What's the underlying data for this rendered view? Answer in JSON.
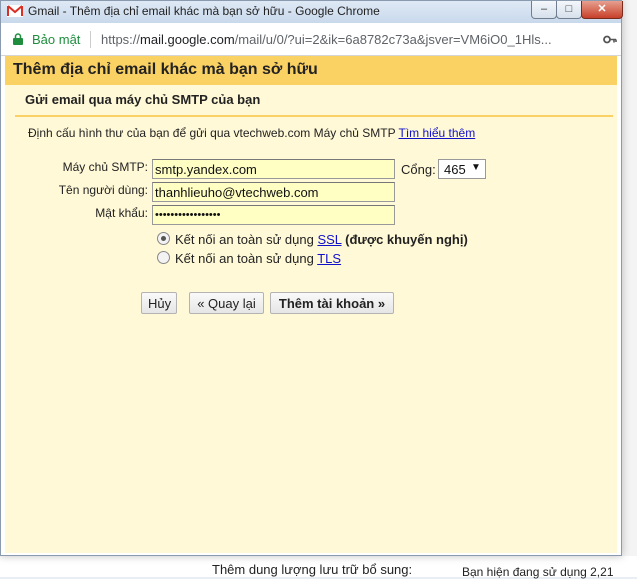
{
  "window": {
    "title": "Gmail - Thêm địa chỉ email khác mà bạn sở hữu - Google Chrome",
    "min_label": "–",
    "max_label": "□",
    "close_label": "✕"
  },
  "address_bar": {
    "secure_label": "Bảo mật",
    "url_scheme": "https://",
    "url_host": "mail.google.com",
    "url_path": "/mail/u/0/?ui=2&ik=6a8782c73a&jsver=VM6iO0_1Hls..."
  },
  "dialog": {
    "title": "Thêm địa chỉ email khác mà bạn sở hữu",
    "subtitle": "Gửi email qua máy chủ SMTP của bạn",
    "description": "Định cấu hình thư của bạn để gửi qua vtechweb.com Máy chủ SMTP",
    "learn_more": "Tìm hiểu thêm",
    "smtp_label": "Máy chủ SMTP:",
    "smtp_value": "smtp.yandex.com",
    "port_label": "Cổng:",
    "port_value": "465",
    "username_label": "Tên người dùng:",
    "username_value": "thanhlieuho@vtechweb.com",
    "password_label": "Mật khẩu:",
    "password_value": "•••••••••••••••••",
    "ssl_prefix": "Kết nối an toàn sử dụng",
    "ssl_link": "SSL",
    "ssl_suffix": "(được khuyến nghị)",
    "ssl_selected": true,
    "tls_prefix": "Kết nối an toàn sử dụng",
    "tls_link": "TLS",
    "tls_selected": false,
    "cancel_button": "Hủy",
    "back_button": "« Quay lại",
    "add_button": "Thêm tài khoản »"
  },
  "background": {
    "bottom_text_1": "Thêm dung lượng lưu trữ bổ sung:",
    "bottom_text_2": "Bạn hiện đang sử dụng 2,21"
  },
  "colors": {
    "header": "#fad163",
    "dialog_bg": "#fff9d7",
    "input_bg": "#ffffc4",
    "link": "#1111cc",
    "secure": "#1e8e3e"
  }
}
